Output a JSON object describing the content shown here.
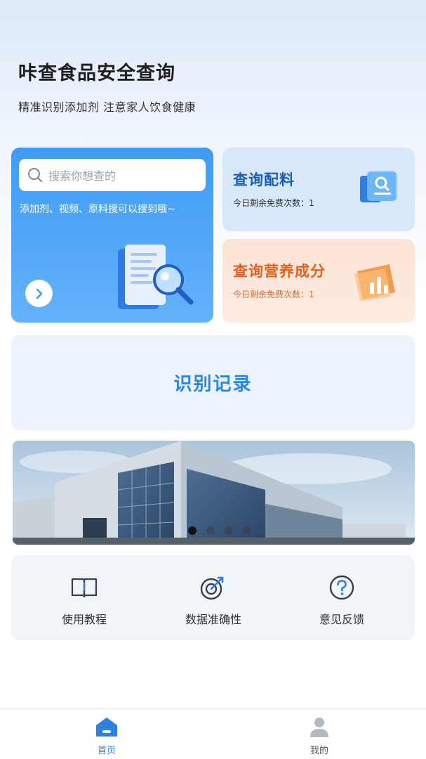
{
  "header": {
    "title": "咔查食品安全查询",
    "subtitle": "精准识别添加剂 注意家人饮食健康"
  },
  "search_card": {
    "placeholder": "搜索你想查的",
    "hint": "添加剂、视频、原料搜可以搜到哦~",
    "icons": [
      "search-icon",
      "chevron-right-icon",
      "document-magnifier-icon"
    ]
  },
  "ingredient_card": {
    "title": "查询配料",
    "remaining": "今日剩余免费次数：1",
    "icon": "search-document-icon"
  },
  "nutrition_card": {
    "title": "查询营养成分",
    "remaining": "今日剩余免费次数：1",
    "icon": "bar-chart-icon"
  },
  "records": {
    "label": "识别记录"
  },
  "banner": {
    "slide_count": 4,
    "active_index": 0
  },
  "shortcuts": [
    {
      "label": "使用教程",
      "icon": "book-icon"
    },
    {
      "label": "数据准确性",
      "icon": "target-icon"
    },
    {
      "label": "意见反馈",
      "icon": "question-icon"
    }
  ],
  "tabbar": {
    "home_label": "首页",
    "me_label": "我的"
  },
  "colors": {
    "primary": "#2d7fe0",
    "nutrition_accent": "#e2611e",
    "search_card_top": "#3f9cf6"
  }
}
